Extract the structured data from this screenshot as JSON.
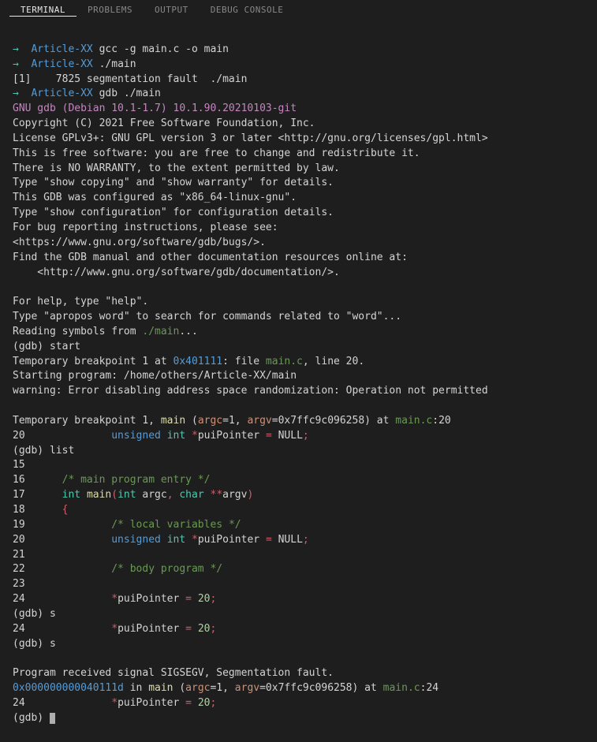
{
  "tabs": {
    "terminal": "TERMINAL",
    "problems": "PROBLEMS",
    "output": "OUTPUT",
    "debug_console": "DEBUG CONSOLE"
  },
  "prompt": {
    "arrow": "→",
    "path": "Article-XX",
    "cmd_compile": "gcc -g main.c -o main",
    "cmd_run": "./main",
    "segfault": "[1]    7825 segmentation fault  ./main",
    "cmd_gdb": "gdb ./main"
  },
  "gdb_banner": {
    "l1": "GNU gdb (Debian 10.1-1.7) 10.1.90.20210103-git",
    "l2": "Copyright (C) 2021 Free Software Foundation, Inc.",
    "l3": "License GPLv3+: GNU GPL version 3 or later <http://gnu.org/licenses/gpl.html>",
    "l4": "This is free software: you are free to change and redistribute it.",
    "l5": "There is NO WARRANTY, to the extent permitted by law.",
    "l6": "Type \"show copying\" and \"show warranty\" for details.",
    "l7": "This GDB was configured as \"x86_64-linux-gnu\".",
    "l8": "Type \"show configuration\" for configuration details.",
    "l9": "For bug reporting instructions, please see:",
    "l10": "<https://www.gnu.org/software/gdb/bugs/>.",
    "l11": "Find the GDB manual and other documentation resources online at:",
    "l12": "    <http://www.gnu.org/software/gdb/documentation/>.",
    "l13": "",
    "l14": "For help, type \"help\".",
    "l15": "Type \"apropos word\" to search for commands related to \"word\"...",
    "reading": "Reading symbols from ",
    "main_path": "./main",
    "dots": "..."
  },
  "gdb": {
    "prompt": "(gdb) ",
    "cmd_start": "start",
    "bp_pre": "Temporary breakpoint 1 at ",
    "bp_addr": "0x401111",
    "bp_mid": ": file ",
    "bp_file": "main.c",
    "bp_post": ", line 20.",
    "starting": "Starting program: /home/others/Article-XX/main",
    "warn": "warning: Error disabling address space randomization: Operation not permitted",
    "bp1": "Temporary breakpoint 1, ",
    "main": "main",
    "paren_open": " (",
    "argc": "argc",
    "eq1": "=1, ",
    "argv": "argv",
    "argv_val": "=0x7ffc9c096258) at ",
    "mainc": "main.c",
    "line20": ":20",
    "cmd_list": "list",
    "cmd_s": "s",
    "sigsegv": "Program received signal SIGSEGV, Segmentation fault.",
    "fault_addr": "0x000000000040111d",
    "fault_in": " in ",
    "line24": ":24"
  },
  "src": {
    "n15": "15",
    "n16": "16",
    "n17": "17",
    "n18": "18",
    "n19": "19",
    "n20": "20",
    "n21": "21",
    "n22": "22",
    "n23": "23",
    "n24": "24",
    "c_entry": "/* main program entry */",
    "c_locals": "/* local variables */",
    "c_body": "/* body program */",
    "kw_int": "int",
    "kw_unsigned": "unsigned",
    "kw_char": "char",
    "main": "main",
    "argc": "argc",
    "argv": "argv",
    "pui": "puiPointer",
    "eq": " = ",
    "null": "NULL",
    "twenty": "20",
    "semi": ";",
    "brace_open": "{",
    "paren_open": "(",
    "paren_close": ")",
    "comma": ",",
    "star": "*",
    "dstar": "**"
  }
}
